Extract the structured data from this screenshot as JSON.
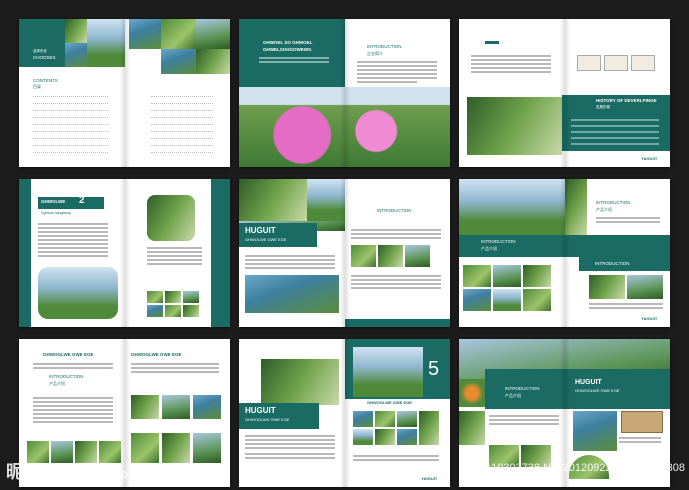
{
  "page": {
    "background": "#1c1c1c",
    "accent": "#1a6b63"
  },
  "s1": {
    "chooses_cn": "选择优化",
    "chooses": "CHOOSES",
    "contents": "CONTENTS",
    "contents_cn": "目录"
  },
  "s2": {
    "heading1": "GHWOEL SO GHWOEL",
    "heading2": "GHWELSOHGOWEWG",
    "intro": "INTRODUCTION",
    "intro_cn": "企业简介"
  },
  "s3": {
    "history": "HISTORY OF DEVERLPINGE",
    "history_cn": "发展历程",
    "footer": "HUGUIT"
  },
  "s4": {
    "title": "GHWOLWE",
    "subtitle": "Cghwse hohgwsng",
    "num": "2"
  },
  "s5": {
    "brand": "HUGUIT",
    "brand_sub": "GHWOLWE GWE EGE",
    "intro": "INTRODUCTION"
  },
  "s6": {
    "intro1": "INTRODUCTION",
    "intro1_cn": "产品介绍",
    "intro2": "INTRODUCTION",
    "intro2_cn": "产品介绍",
    "intro3": "INTRODUCTION",
    "footer": "HUGUIT"
  },
  "s7": {
    "heading": "GHWOGLWE GWE EGE",
    "heading2": "GHWOGLWE GWE EGE",
    "intro": "INTRODUCTION",
    "intro_cn": "产品介绍"
  },
  "s8": {
    "brand": "HUGUIT",
    "brand_sub": "GHWOGLWE GWE EGE",
    "num": "5",
    "caption": "GHWOGLWE GWE EGE",
    "footer": "HUGUIT"
  },
  "s9": {
    "intro": "INTRODUCTION",
    "intro_cn": "产品介绍",
    "brand": "HUGUIT",
    "brand_sub": "GHWOGLWE GWE EGE"
  },
  "watermark": {
    "left_main": "昵图网",
    "left_url": "www.nipic.com",
    "right": "ID:10303738 NO:20120922080604002308"
  }
}
